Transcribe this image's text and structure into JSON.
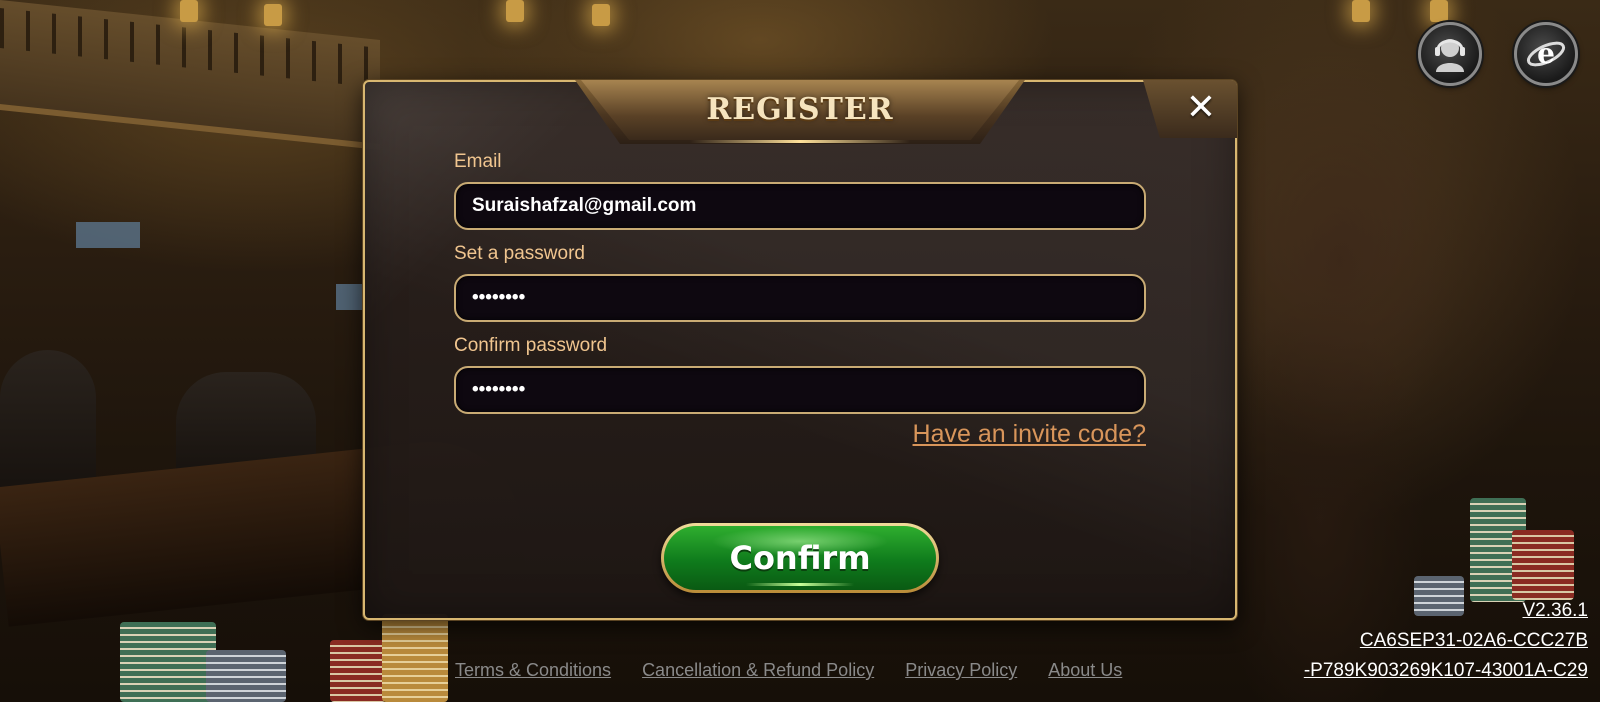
{
  "dialog": {
    "title": "REGISTER",
    "close_symbol": "✕"
  },
  "form": {
    "email": {
      "label": "Email",
      "value": "Suraishafzal@gmail.com"
    },
    "password": {
      "label": "Set a password",
      "value": "••••••••"
    },
    "confirm_password": {
      "label": "Confirm password",
      "value": "••••••••"
    },
    "invite_link": "Have an invite code?",
    "confirm_button": "Confirm"
  },
  "top_icons": {
    "support": "customer-support-icon",
    "browser": "browser-icon"
  },
  "footer": {
    "links": [
      "Terms & Conditions",
      "Cancellation & Refund Policy",
      "Privacy Policy",
      "About Us"
    ]
  },
  "version": {
    "line1": "V2.36.1",
    "line2": "CA6SEP31-02A6-CCC27B",
    "line3": "-P789K903269K107-43001A-C29"
  },
  "colors": {
    "gold_border": "#d8b771",
    "label": "#f0c58f",
    "link": "#d8955a",
    "confirm_green": "#1f9a26"
  }
}
